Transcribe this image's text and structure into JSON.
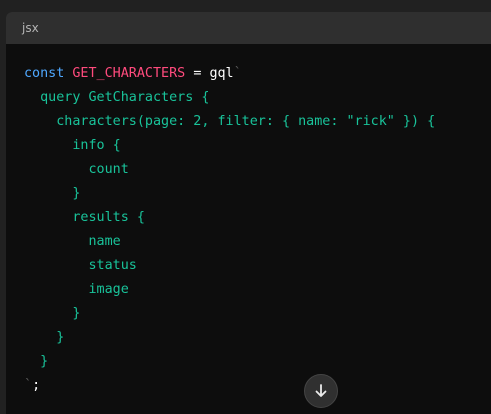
{
  "code_block": {
    "language": "jsx",
    "lines": [
      {
        "kw": "const",
        "var": "GET_CHARACTERS",
        "op": "=",
        "fn": "gql",
        "bt": "`"
      },
      "  query GetCharacters {",
      "    characters(page: 2, filter: { name: \"rick\" }) {",
      "      info {",
      "        count",
      "      }",
      "      results {",
      "        name",
      "        status",
      "        image",
      "      }",
      "    }",
      "  }",
      {
        "bt": "`",
        "end": ";"
      }
    ]
  },
  "scroll_button": {
    "icon": "arrow-down-icon"
  }
}
